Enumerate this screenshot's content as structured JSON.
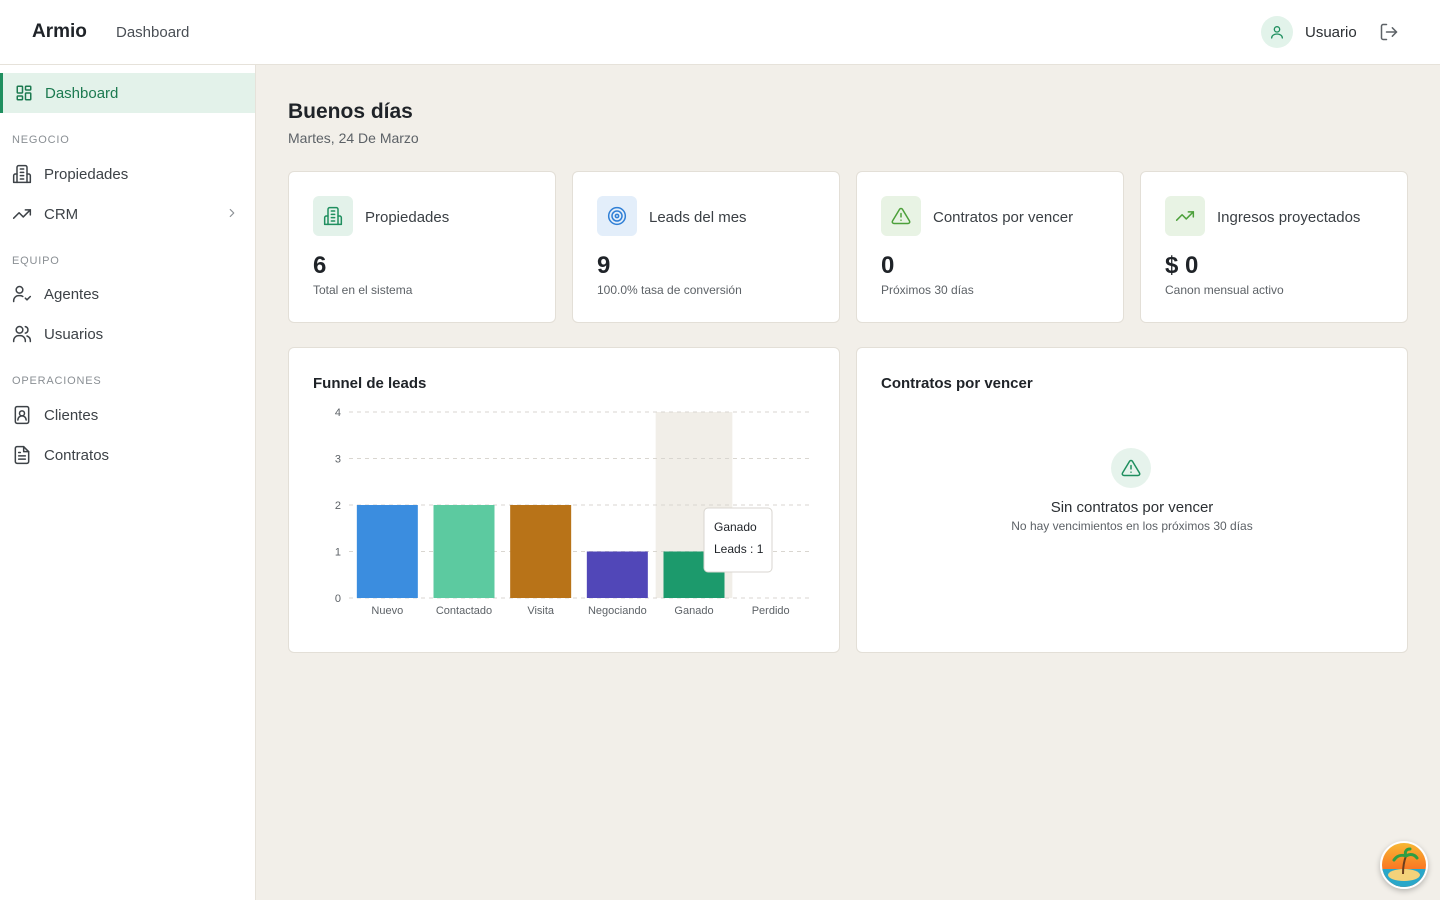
{
  "header": {
    "brand": "Armio",
    "breadcrumb": "Dashboard",
    "user_name": "Usuario",
    "icons": {
      "user": "user-icon",
      "logout": "logout-icon"
    }
  },
  "sidebar": {
    "active": {
      "label": "Dashboard",
      "icon": "grid-icon"
    },
    "sections": [
      {
        "label": "NEGOCIO",
        "items": [
          {
            "label": "Propiedades",
            "icon": "building-icon"
          },
          {
            "label": "CRM",
            "icon": "trend-icon",
            "has_children": true
          }
        ]
      },
      {
        "label": "EQUIPO",
        "items": [
          {
            "label": "Agentes",
            "icon": "user-check-icon"
          },
          {
            "label": "Usuarios",
            "icon": "users-icon"
          }
        ]
      },
      {
        "label": "OPERACIONES",
        "items": [
          {
            "label": "Clientes",
            "icon": "contact-book-icon"
          },
          {
            "label": "Contratos",
            "icon": "document-icon"
          }
        ]
      }
    ]
  },
  "page": {
    "greeting": "Buenos días",
    "date": "Martes, 24 De Marzo"
  },
  "stats": [
    {
      "title": "Propiedades",
      "value": "6",
      "sub": "Total en el sistema",
      "icon": "building-icon",
      "color": "#1f8f5f"
    },
    {
      "title": "Leads del mes",
      "value": "9",
      "sub": "100.0% tasa de conversión",
      "icon": "target-icon",
      "color": "#2f7fd6"
    },
    {
      "title": "Contratos por vencer",
      "value": "0",
      "sub": "Próximos 30 días",
      "icon": "alert-triangle-icon",
      "color": "#4ca03a"
    },
    {
      "title": "Ingresos proyectados",
      "value": "$ 0",
      "sub": "Canon mensual activo",
      "icon": "trend-up-icon",
      "color": "#4ca03a"
    }
  ],
  "funnel": {
    "title": "Funnel de leads",
    "tooltip": {
      "label": "Ganado",
      "text": "Leads : 1"
    },
    "chart_data": {
      "type": "bar",
      "categories": [
        "Nuevo",
        "Contactado",
        "Visita",
        "Negociando",
        "Ganado",
        "Perdido"
      ],
      "values": [
        2,
        2,
        2,
        1,
        1,
        0
      ],
      "colors": [
        "#3b8ddf",
        "#5ccaa0",
        "#b87318",
        "#5147b8",
        "#1c9a6c",
        "#999999"
      ],
      "yticks": [
        "0",
        "1",
        "2",
        "3",
        "4"
      ],
      "ylim": [
        0,
        4
      ],
      "grid": true,
      "highlighted": "Ganado"
    }
  },
  "contracts": {
    "title": "Contratos por vencer",
    "empty_title": "Sin contratos por vencer",
    "empty_sub": "No hay vencimientos en los próximos 30 días",
    "icon": "alert-triangle-icon"
  },
  "badge": {
    "icon": "island-avatar-icon"
  }
}
